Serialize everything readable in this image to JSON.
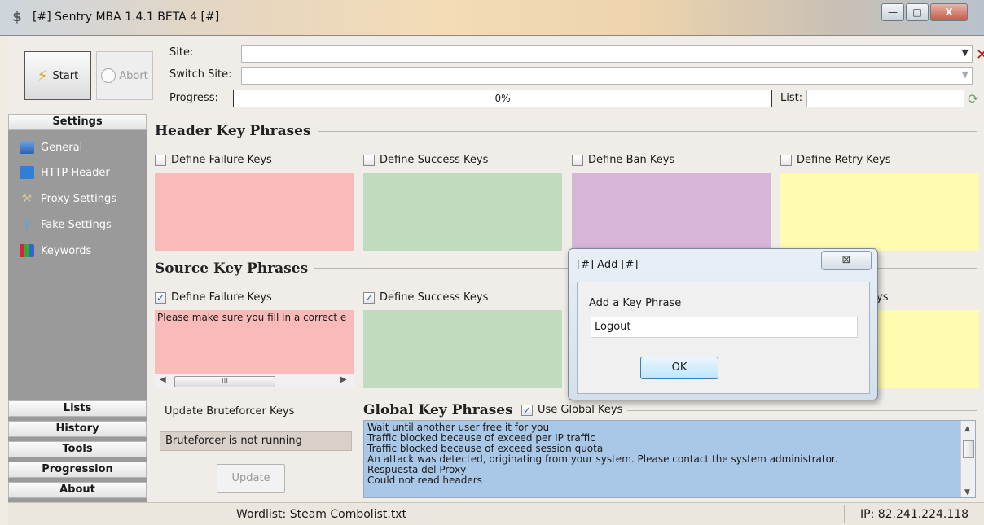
{
  "window": {
    "title": "[#] Sentry MBA 1.4.1 BETA 4 [#]",
    "min_glyph": "—",
    "max_glyph": "□",
    "close_glyph": "X"
  },
  "top": {
    "start_label": "Start",
    "abort_label": "Abort",
    "site_label": "Site:",
    "site_value": "",
    "switch_site_label": "Switch Site:",
    "switch_site_value": "",
    "progress_label": "Progress:",
    "progress_value": "0%",
    "list_label": "List:",
    "list_value": ""
  },
  "sidebar": {
    "settings_header": "Settings",
    "items": [
      {
        "label": "General",
        "icon": "general-icon"
      },
      {
        "label": "HTTP Header",
        "icon": "http-header-icon"
      },
      {
        "label": "Proxy Settings",
        "icon": "proxy-settings-icon"
      },
      {
        "label": "Fake Settings",
        "icon": "fake-settings-icon"
      },
      {
        "label": "Keywords",
        "icon": "keywords-icon"
      }
    ],
    "bottom_sections": [
      "Lists",
      "History",
      "Tools",
      "Progression",
      "About"
    ]
  },
  "header_keys": {
    "title": "Header Key Phrases",
    "failure": {
      "label": "Define Failure Keys",
      "checked": false
    },
    "success": {
      "label": "Define Success Keys",
      "checked": false
    },
    "ban": {
      "label": "Define Ban Keys",
      "checked": false
    },
    "retry": {
      "label": "Define Retry Keys",
      "checked": false
    }
  },
  "source_keys": {
    "title": "Source Key Phrases",
    "failure": {
      "label": "Define Failure Keys",
      "checked": true,
      "text": "Please make sure you fill in a correct e"
    },
    "success": {
      "label": "Define Success Keys",
      "checked": true
    },
    "retry_partial": "ys",
    "scroll_grip": "III"
  },
  "bruteforcer": {
    "label": "Update Bruteforcer Keys",
    "status": "Bruteforcer is not running",
    "update_label": "Update"
  },
  "global_keys": {
    "title": "Global Key Phrases",
    "use_label": "Use Global Keys",
    "use_checked": true,
    "items": [
      "Wait until another user free it for you",
      "Traffic blocked because of exceed per IP traffic",
      "Traffic blocked because of exceed session quota",
      "An attack was detected, originating from your system. Please contact the system administrator.",
      "Respuesta del Proxy",
      "Could not read headers"
    ]
  },
  "statusbar": {
    "wordlist": "Wordlist: Steam Combolist.txt",
    "ip": "IP: 82.241.224.118"
  },
  "dialog": {
    "title": "[#] Add [#]",
    "close_glyph": "⊠",
    "prompt": "Add a Key Phrase",
    "value": "Logout",
    "ok_label": "OK"
  },
  "colors": {
    "failure": "#fbbaba",
    "success": "#c1dbc0",
    "ban": "#d7b4da",
    "retry": "#fffbaf",
    "global_list": "#a9c7e7",
    "sidebar": "#9a9a9a"
  }
}
